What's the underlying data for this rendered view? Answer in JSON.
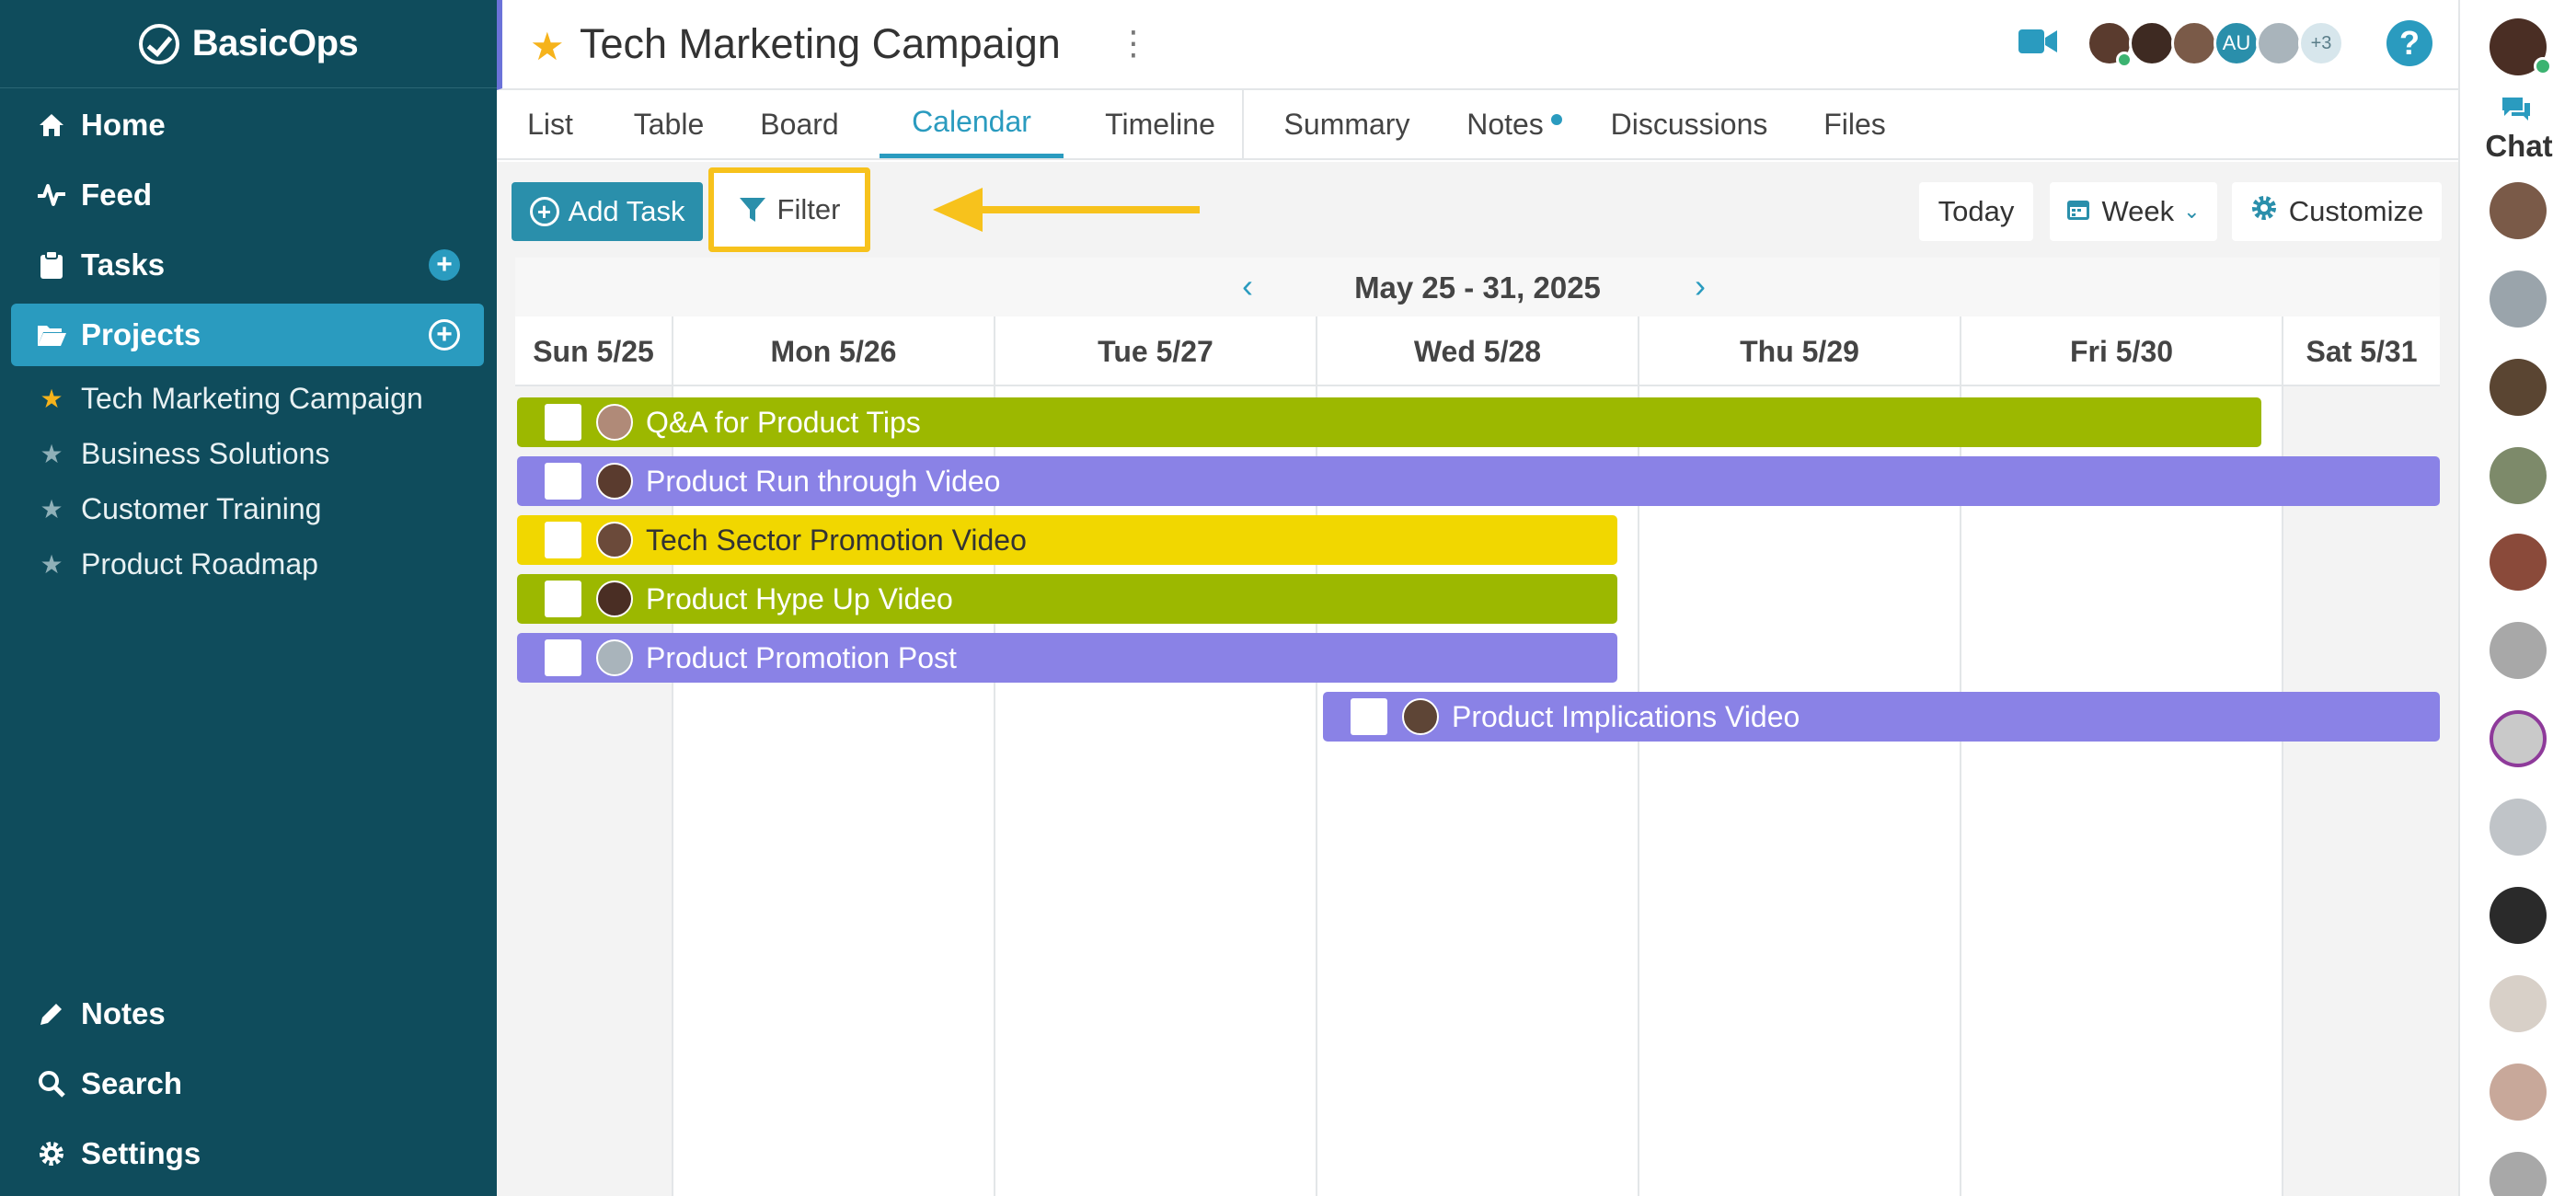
{
  "app": {
    "logo_text": "BasicOps"
  },
  "sidebar": {
    "nav": [
      {
        "label": "Home",
        "icon": "home-icon"
      },
      {
        "label": "Feed",
        "icon": "pulse-icon"
      },
      {
        "label": "Tasks",
        "icon": "clipboard-icon"
      },
      {
        "label": "Projects",
        "icon": "folder-open-icon"
      }
    ],
    "projects": [
      {
        "label": "Tech Marketing Campaign",
        "favorite": true
      },
      {
        "label": "Business Solutions",
        "favorite": false
      },
      {
        "label": "Customer Training",
        "favorite": false
      },
      {
        "label": "Product Roadmap",
        "favorite": false
      }
    ],
    "bottom": [
      {
        "label": "Notes",
        "icon": "pencil-icon"
      },
      {
        "label": "Search",
        "icon": "search-icon"
      },
      {
        "label": "Settings",
        "icon": "gear-icon"
      }
    ]
  },
  "header": {
    "title": "Tech Marketing Campaign",
    "members_initials": "AU",
    "members_more": "+3",
    "help_label": "?"
  },
  "tabs": [
    {
      "label": "List"
    },
    {
      "label": "Table"
    },
    {
      "label": "Board"
    },
    {
      "label": "Calendar",
      "active": true
    },
    {
      "label": "Timeline"
    },
    {
      "label": "Summary"
    },
    {
      "label": "Notes",
      "has_dot": true
    },
    {
      "label": "Discussions"
    },
    {
      "label": "Files"
    }
  ],
  "toolbar": {
    "add_task": "Add Task",
    "filter": "Filter",
    "today": "Today",
    "week": "Week",
    "customize": "Customize"
  },
  "calendar": {
    "range": "May 25 - 31, 2025",
    "days": [
      "Sun 5/25",
      "Mon 5/26",
      "Tue 5/27",
      "Wed 5/28",
      "Thu 5/29",
      "Fri 5/30",
      "Sat 5/31"
    ],
    "tasks": [
      {
        "label": "Q&A for Product Tips",
        "color": "#9cb800"
      },
      {
        "label": "Product Run through Video",
        "color": "#8a82e6"
      },
      {
        "label": "Tech Sector Promotion Video",
        "color": "#f1d700"
      },
      {
        "label": "Product Hype Up Video",
        "color": "#9cb800"
      },
      {
        "label": "Product Promotion Post",
        "color": "#8a82e6"
      },
      {
        "label": "Product Implications Video",
        "color": "#8a82e6"
      }
    ]
  },
  "chat": {
    "label": "Chat"
  },
  "colors": {
    "sidebar": "#0f4c5c",
    "accent": "#2a9bbf",
    "highlight": "#f7c21c"
  }
}
